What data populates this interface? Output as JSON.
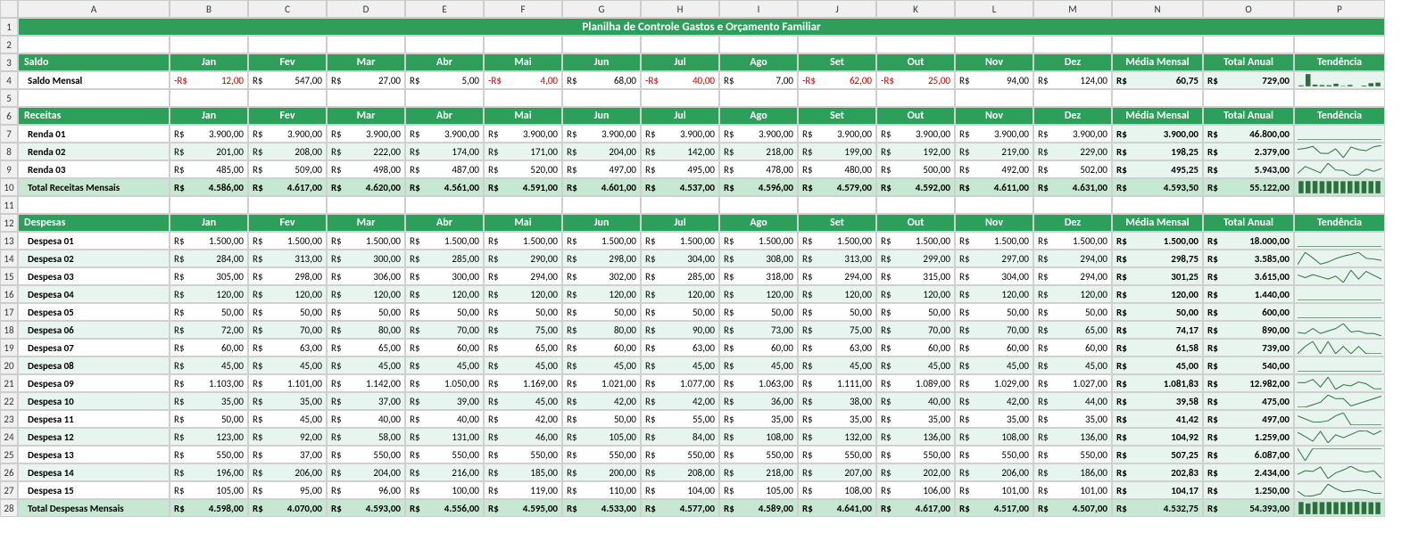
{
  "title": "Planilha de Controle Gastos e Orçamento Familiar",
  "col_letters": [
    "A",
    "B",
    "C",
    "D",
    "E",
    "F",
    "G",
    "H",
    "I",
    "J",
    "K",
    "L",
    "M",
    "N",
    "O",
    "P"
  ],
  "months": [
    "Jan",
    "Fev",
    "Mar",
    "Abr",
    "Mai",
    "Jun",
    "Jul",
    "Ago",
    "Set",
    "Out",
    "Nov",
    "Dez"
  ],
  "extra_hdrs": [
    "Média Mensal",
    "Total Anual",
    "Tendência"
  ],
  "saldo": {
    "label": "Saldo",
    "rows": [
      {
        "label": "Saldo Mensal",
        "vals": [
          -12.0,
          547.0,
          27.0,
          5.0,
          -4.0,
          68.0,
          -40.0,
          7.0,
          -62.0,
          -25.0,
          94.0,
          124.0
        ],
        "media": 60.75,
        "total": 729.0
      }
    ]
  },
  "receitas": {
    "label": "Receitas",
    "rows": [
      {
        "label": "Renda 01",
        "vals": [
          3900.0,
          3900.0,
          3900.0,
          3900.0,
          3900.0,
          3900.0,
          3900.0,
          3900.0,
          3900.0,
          3900.0,
          3900.0,
          3900.0
        ],
        "media": 3900.0,
        "total": 46800.0
      },
      {
        "label": "Renda 02",
        "vals": [
          201.0,
          208.0,
          222.0,
          174.0,
          171.0,
          204.0,
          142.0,
          218.0,
          199.0,
          192.0,
          219.0,
          229.0
        ],
        "media": 198.25,
        "total": 2379.0
      },
      {
        "label": "Renda 03",
        "vals": [
          485.0,
          509.0,
          498.0,
          487.0,
          520.0,
          497.0,
          495.0,
          478.0,
          480.0,
          500.0,
          492.0,
          502.0
        ],
        "media": 495.25,
        "total": 5943.0
      }
    ],
    "total": {
      "label": "Total Receitas Mensais",
      "vals": [
        4586.0,
        4617.0,
        4620.0,
        4561.0,
        4591.0,
        4601.0,
        4537.0,
        4596.0,
        4579.0,
        4592.0,
        4611.0,
        4631.0
      ],
      "media": 4593.5,
      "total": 55122.0
    }
  },
  "despesas": {
    "label": "Despesas",
    "rows": [
      {
        "label": "Despesa 01",
        "vals": [
          1500.0,
          1500.0,
          1500.0,
          1500.0,
          1500.0,
          1500.0,
          1500.0,
          1500.0,
          1500.0,
          1500.0,
          1500.0,
          1500.0
        ],
        "media": 1500.0,
        "total": 18000.0
      },
      {
        "label": "Despesa 02",
        "vals": [
          284.0,
          313.0,
          300.0,
          285.0,
          290.0,
          298.0,
          304.0,
          308.0,
          313.0,
          299.0,
          297.0,
          294.0
        ],
        "media": 298.75,
        "total": 3585.0
      },
      {
        "label": "Despesa 03",
        "vals": [
          305.0,
          298.0,
          306.0,
          300.0,
          294.0,
          302.0,
          285.0,
          318.0,
          294.0,
          315.0,
          304.0,
          294.0
        ],
        "media": 301.25,
        "total": 3615.0
      },
      {
        "label": "Despesa 04",
        "vals": [
          120.0,
          120.0,
          120.0,
          120.0,
          120.0,
          120.0,
          120.0,
          120.0,
          120.0,
          120.0,
          120.0,
          120.0
        ],
        "media": 120.0,
        "total": 1440.0
      },
      {
        "label": "Despesa 05",
        "vals": [
          50.0,
          50.0,
          50.0,
          50.0,
          50.0,
          50.0,
          50.0,
          50.0,
          50.0,
          50.0,
          50.0,
          50.0
        ],
        "media": 50.0,
        "total": 600.0
      },
      {
        "label": "Despesa 06",
        "vals": [
          72.0,
          70.0,
          80.0,
          70.0,
          75.0,
          80.0,
          90.0,
          73.0,
          75.0,
          70.0,
          70.0,
          65.0
        ],
        "media": 74.17,
        "total": 890.0
      },
      {
        "label": "Despesa 07",
        "vals": [
          60.0,
          63.0,
          65.0,
          60.0,
          65.0,
          60.0,
          63.0,
          60.0,
          63.0,
          60.0,
          60.0,
          60.0
        ],
        "media": 61.58,
        "total": 739.0
      },
      {
        "label": "Despesa 08",
        "vals": [
          45.0,
          45.0,
          45.0,
          45.0,
          45.0,
          45.0,
          45.0,
          45.0,
          45.0,
          45.0,
          45.0,
          45.0
        ],
        "media": 45.0,
        "total": 540.0
      },
      {
        "label": "Despesa 09",
        "vals": [
          1103.0,
          1101.0,
          1142.0,
          1050.0,
          1169.0,
          1021.0,
          1077.0,
          1063.0,
          1111.0,
          1089.0,
          1029.0,
          1027.0
        ],
        "media": 1081.83,
        "total": 12982.0
      },
      {
        "label": "Despesa 10",
        "vals": [
          35.0,
          35.0,
          37.0,
          39.0,
          45.0,
          42.0,
          42.0,
          36.0,
          38.0,
          40.0,
          42.0,
          44.0
        ],
        "media": 39.58,
        "total": 475.0
      },
      {
        "label": "Despesa 11",
        "vals": [
          50.0,
          45.0,
          40.0,
          40.0,
          42.0,
          50.0,
          55.0,
          35.0,
          35.0,
          35.0,
          35.0,
          35.0
        ],
        "media": 41.42,
        "total": 497.0
      },
      {
        "label": "Despesa 12",
        "vals": [
          123.0,
          92.0,
          58.0,
          131.0,
          46.0,
          105.0,
          84.0,
          108.0,
          132.0,
          136.0,
          108.0,
          136.0
        ],
        "media": 104.92,
        "total": 1259.0
      },
      {
        "label": "Despesa 13",
        "vals": [
          550.0,
          37.0,
          550.0,
          550.0,
          550.0,
          550.0,
          550.0,
          550.0,
          550.0,
          550.0,
          550.0,
          550.0
        ],
        "media": 507.25,
        "total": 6087.0
      },
      {
        "label": "Despesa 14",
        "vals": [
          196.0,
          206.0,
          204.0,
          216.0,
          185.0,
          200.0,
          208.0,
          218.0,
          207.0,
          202.0,
          206.0,
          186.0
        ],
        "media": 202.83,
        "total": 2434.0
      },
      {
        "label": "Despesa 15",
        "vals": [
          105.0,
          95.0,
          96.0,
          100.0,
          119.0,
          110.0,
          104.0,
          105.0,
          108.0,
          106.0,
          101.0,
          101.0
        ],
        "media": 104.17,
        "total": 1250.0
      }
    ],
    "total": {
      "label": "Total Despesas Mensais",
      "vals": [
        4598.0,
        4070.0,
        4593.0,
        4556.0,
        4595.0,
        4533.0,
        4577.0,
        4589.0,
        4641.0,
        4617.0,
        4517.0,
        4507.0
      ],
      "media": 4532.75,
      "total": 54393.0
    }
  },
  "currency_prefix": "R$",
  "neg_prefix": "-R$"
}
